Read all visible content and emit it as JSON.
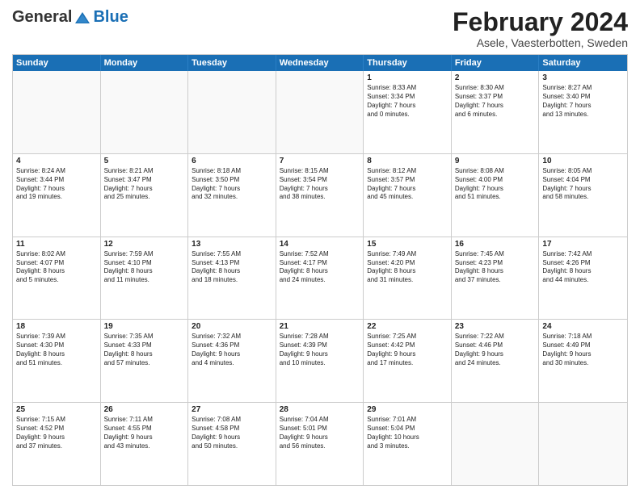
{
  "logo": {
    "general": "General",
    "blue": "Blue"
  },
  "title": "February 2024",
  "subtitle": "Asele, Vaesterbotten, Sweden",
  "days": [
    "Sunday",
    "Monday",
    "Tuesday",
    "Wednesday",
    "Thursday",
    "Friday",
    "Saturday"
  ],
  "weeks": [
    [
      {
        "num": "",
        "text": "",
        "empty": true
      },
      {
        "num": "",
        "text": "",
        "empty": true
      },
      {
        "num": "",
        "text": "",
        "empty": true
      },
      {
        "num": "",
        "text": "",
        "empty": true
      },
      {
        "num": "1",
        "text": "Sunrise: 8:33 AM\nSunset: 3:34 PM\nDaylight: 7 hours\nand 0 minutes.",
        "empty": false
      },
      {
        "num": "2",
        "text": "Sunrise: 8:30 AM\nSunset: 3:37 PM\nDaylight: 7 hours\nand 6 minutes.",
        "empty": false
      },
      {
        "num": "3",
        "text": "Sunrise: 8:27 AM\nSunset: 3:40 PM\nDaylight: 7 hours\nand 13 minutes.",
        "empty": false
      }
    ],
    [
      {
        "num": "4",
        "text": "Sunrise: 8:24 AM\nSunset: 3:44 PM\nDaylight: 7 hours\nand 19 minutes.",
        "empty": false
      },
      {
        "num": "5",
        "text": "Sunrise: 8:21 AM\nSunset: 3:47 PM\nDaylight: 7 hours\nand 25 minutes.",
        "empty": false
      },
      {
        "num": "6",
        "text": "Sunrise: 8:18 AM\nSunset: 3:50 PM\nDaylight: 7 hours\nand 32 minutes.",
        "empty": false
      },
      {
        "num": "7",
        "text": "Sunrise: 8:15 AM\nSunset: 3:54 PM\nDaylight: 7 hours\nand 38 minutes.",
        "empty": false
      },
      {
        "num": "8",
        "text": "Sunrise: 8:12 AM\nSunset: 3:57 PM\nDaylight: 7 hours\nand 45 minutes.",
        "empty": false
      },
      {
        "num": "9",
        "text": "Sunrise: 8:08 AM\nSunset: 4:00 PM\nDaylight: 7 hours\nand 51 minutes.",
        "empty": false
      },
      {
        "num": "10",
        "text": "Sunrise: 8:05 AM\nSunset: 4:04 PM\nDaylight: 7 hours\nand 58 minutes.",
        "empty": false
      }
    ],
    [
      {
        "num": "11",
        "text": "Sunrise: 8:02 AM\nSunset: 4:07 PM\nDaylight: 8 hours\nand 5 minutes.",
        "empty": false
      },
      {
        "num": "12",
        "text": "Sunrise: 7:59 AM\nSunset: 4:10 PM\nDaylight: 8 hours\nand 11 minutes.",
        "empty": false
      },
      {
        "num": "13",
        "text": "Sunrise: 7:55 AM\nSunset: 4:13 PM\nDaylight: 8 hours\nand 18 minutes.",
        "empty": false
      },
      {
        "num": "14",
        "text": "Sunrise: 7:52 AM\nSunset: 4:17 PM\nDaylight: 8 hours\nand 24 minutes.",
        "empty": false
      },
      {
        "num": "15",
        "text": "Sunrise: 7:49 AM\nSunset: 4:20 PM\nDaylight: 8 hours\nand 31 minutes.",
        "empty": false
      },
      {
        "num": "16",
        "text": "Sunrise: 7:45 AM\nSunset: 4:23 PM\nDaylight: 8 hours\nand 37 minutes.",
        "empty": false
      },
      {
        "num": "17",
        "text": "Sunrise: 7:42 AM\nSunset: 4:26 PM\nDaylight: 8 hours\nand 44 minutes.",
        "empty": false
      }
    ],
    [
      {
        "num": "18",
        "text": "Sunrise: 7:39 AM\nSunset: 4:30 PM\nDaylight: 8 hours\nand 51 minutes.",
        "empty": false
      },
      {
        "num": "19",
        "text": "Sunrise: 7:35 AM\nSunset: 4:33 PM\nDaylight: 8 hours\nand 57 minutes.",
        "empty": false
      },
      {
        "num": "20",
        "text": "Sunrise: 7:32 AM\nSunset: 4:36 PM\nDaylight: 9 hours\nand 4 minutes.",
        "empty": false
      },
      {
        "num": "21",
        "text": "Sunrise: 7:28 AM\nSunset: 4:39 PM\nDaylight: 9 hours\nand 10 minutes.",
        "empty": false
      },
      {
        "num": "22",
        "text": "Sunrise: 7:25 AM\nSunset: 4:42 PM\nDaylight: 9 hours\nand 17 minutes.",
        "empty": false
      },
      {
        "num": "23",
        "text": "Sunrise: 7:22 AM\nSunset: 4:46 PM\nDaylight: 9 hours\nand 24 minutes.",
        "empty": false
      },
      {
        "num": "24",
        "text": "Sunrise: 7:18 AM\nSunset: 4:49 PM\nDaylight: 9 hours\nand 30 minutes.",
        "empty": false
      }
    ],
    [
      {
        "num": "25",
        "text": "Sunrise: 7:15 AM\nSunset: 4:52 PM\nDaylight: 9 hours\nand 37 minutes.",
        "empty": false
      },
      {
        "num": "26",
        "text": "Sunrise: 7:11 AM\nSunset: 4:55 PM\nDaylight: 9 hours\nand 43 minutes.",
        "empty": false
      },
      {
        "num": "27",
        "text": "Sunrise: 7:08 AM\nSunset: 4:58 PM\nDaylight: 9 hours\nand 50 minutes.",
        "empty": false
      },
      {
        "num": "28",
        "text": "Sunrise: 7:04 AM\nSunset: 5:01 PM\nDaylight: 9 hours\nand 56 minutes.",
        "empty": false
      },
      {
        "num": "29",
        "text": "Sunrise: 7:01 AM\nSunset: 5:04 PM\nDaylight: 10 hours\nand 3 minutes.",
        "empty": false
      },
      {
        "num": "",
        "text": "",
        "empty": true
      },
      {
        "num": "",
        "text": "",
        "empty": true
      }
    ]
  ]
}
